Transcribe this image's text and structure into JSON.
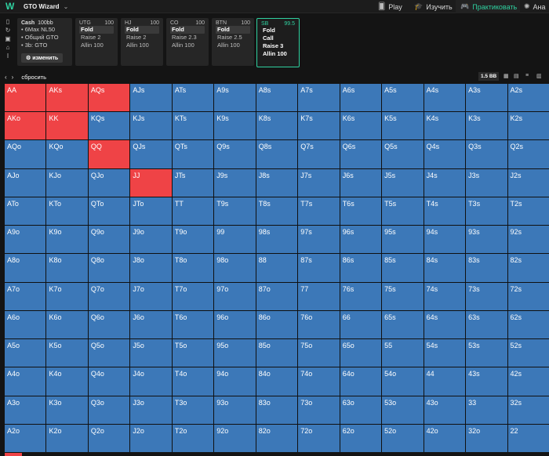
{
  "app": {
    "title": "GTO Wizard"
  },
  "nav": [
    {
      "label": "Play",
      "icon": "cards-icon"
    },
    {
      "label": "Изучить",
      "icon": "graduation-cap-icon"
    },
    {
      "label": "Практиковать",
      "icon": "gamepad-icon",
      "active": true
    },
    {
      "label": "Ана",
      "icon": "bulb-icon"
    }
  ],
  "config": {
    "title": "Cash",
    "stack": "100bb",
    "lines": [
      "6Max NL50",
      "Общий GTO",
      "3b: GTO"
    ],
    "edit_label": "изменить"
  },
  "positions": [
    {
      "name": "UTG",
      "stack": "100",
      "actions": [
        "Fold",
        "Raise 2",
        "Allin 100"
      ],
      "selected": 0
    },
    {
      "name": "HJ",
      "stack": "100",
      "actions": [
        "Fold",
        "Raise 2",
        "Allin 100"
      ],
      "selected": 0
    },
    {
      "name": "CO",
      "stack": "100",
      "actions": [
        "Fold",
        "Raise 2.3",
        "Allin 100"
      ],
      "selected": 0
    },
    {
      "name": "BTN",
      "stack": "100",
      "actions": [
        "Fold",
        "Raise 2.5",
        "Allin 100"
      ],
      "selected": 0
    },
    {
      "name": "SB",
      "stack": "99.5",
      "actions": [
        "Fold",
        "Call",
        "Raise 3",
        "Allin 100"
      ],
      "current": true
    }
  ],
  "toolbar": {
    "prev": "‹",
    "next": "›",
    "reset_label": "сбросить",
    "bb_label": "1.5 BB"
  },
  "colors": {
    "raise": "#ef4346",
    "fold": "#3c78b8",
    "accent": "#2fd1a0"
  },
  "grid": {
    "ranks": [
      "A",
      "K",
      "Q",
      "J",
      "T",
      "9",
      "8",
      "7",
      "6",
      "5",
      "4",
      "3",
      "2"
    ],
    "raise_hands": [
      "AA",
      "AKs",
      "AQs",
      "AKo",
      "KK",
      "QQ",
      "JJ"
    ]
  }
}
